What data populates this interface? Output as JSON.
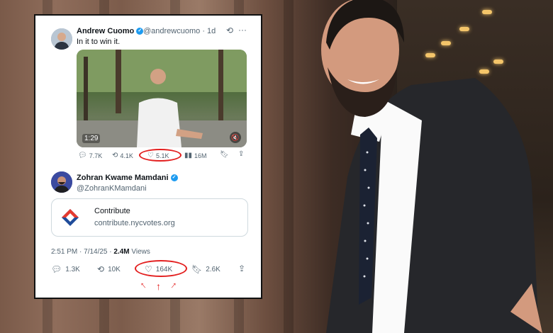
{
  "tweet": {
    "author_name": "Andrew Cuomo",
    "author_handle": "@andrewcuomo",
    "time_ago": "· 1d",
    "text": "In it to win it.",
    "video_time": "1:29",
    "metrics": {
      "replies": "7.7K",
      "reposts": "4.1K",
      "likes": "5.1K",
      "views": "16M"
    }
  },
  "reply": {
    "author_name": "Zohran Kwame Mamdani",
    "author_handle": "@ZohranKMamdani",
    "link_title": "Contribute",
    "link_url": "contribute.nycvotes.org",
    "timestamp": "2:51 PM · 7/14/25 · ",
    "views_count": "2.4M",
    "views_label": " Views",
    "metrics": {
      "replies": "1.3K",
      "reposts": "10K",
      "likes": "164K",
      "bookmarks": "2.6K"
    }
  },
  "colors": {
    "accent": "#1d9bf0",
    "annotation": "#e32020"
  },
  "icons": [
    "reply-icon",
    "repost-icon",
    "heart-icon",
    "views-icon",
    "bookmark-icon",
    "share-icon",
    "verified-icon",
    "grok-icon",
    "more-icon",
    "mute-icon"
  ]
}
